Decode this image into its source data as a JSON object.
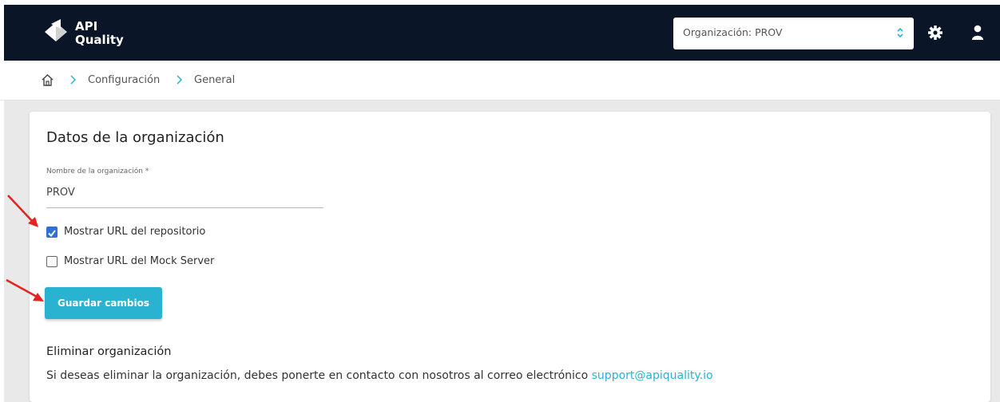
{
  "app": {
    "logo_line1": "API",
    "logo_line2": "Quality"
  },
  "header": {
    "org_select_label": "Organización: PROV"
  },
  "breadcrumb": {
    "items": [
      "Configuración",
      "General"
    ]
  },
  "card": {
    "title": "Datos de la organización",
    "name_field_label": "Nombre de la organización *",
    "name_field_value": "PROV",
    "checkbox_repo_label": "Mostrar URL del repositorio",
    "checkbox_repo_checked": true,
    "checkbox_mock_label": "Mostrar URL del Mock Server",
    "checkbox_mock_checked": false,
    "save_button_label": "Guardar cambios",
    "delete_section_title": "Eliminar organización",
    "delete_section_text": "Si deseas eliminar la organización, debes ponerte en contacto con nosotros al correo electrónico",
    "support_email": "support@apiquality.io"
  },
  "colors": {
    "navbar": "#0a1628",
    "accent": "#29b3d1",
    "checkbox": "#2f6fd6",
    "annotation_arrow": "#e52420"
  },
  "icons": [
    "home-icon",
    "chevron-right-icon",
    "gear-icon",
    "user-icon",
    "select-caret-icon",
    "check-icon",
    "logo-icon"
  ]
}
